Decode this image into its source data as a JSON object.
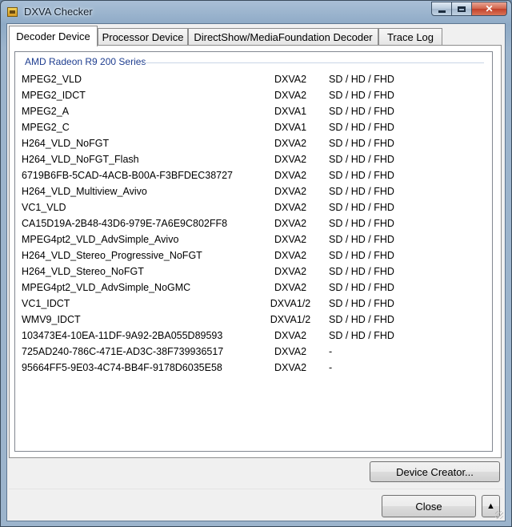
{
  "window": {
    "title": "DXVA Checker"
  },
  "tabs": [
    {
      "label": "Decoder Device"
    },
    {
      "label": "Processor Device"
    },
    {
      "label": "DirectShow/MediaFoundation Decoder"
    },
    {
      "label": "Trace Log"
    }
  ],
  "active_tab": "Decoder Device",
  "group": {
    "title": "AMD Radeon R9 200 Series"
  },
  "rows": [
    {
      "name": "MPEG2_VLD",
      "api": "DXVA2",
      "res": "SD / HD / FHD"
    },
    {
      "name": "MPEG2_IDCT",
      "api": "DXVA2",
      "res": "SD / HD / FHD"
    },
    {
      "name": "MPEG2_A",
      "api": "DXVA1",
      "res": "SD / HD / FHD"
    },
    {
      "name": "MPEG2_C",
      "api": "DXVA1",
      "res": "SD / HD / FHD"
    },
    {
      "name": "H264_VLD_NoFGT",
      "api": "DXVA2",
      "res": "SD / HD / FHD"
    },
    {
      "name": "H264_VLD_NoFGT_Flash",
      "api": "DXVA2",
      "res": "SD / HD / FHD"
    },
    {
      "name": "6719B6FB-5CAD-4ACB-B00A-F3BFDEC38727",
      "api": "DXVA2",
      "res": "SD / HD / FHD"
    },
    {
      "name": "H264_VLD_Multiview_Avivo",
      "api": "DXVA2",
      "res": "SD / HD / FHD"
    },
    {
      "name": "VC1_VLD",
      "api": "DXVA2",
      "res": "SD / HD / FHD"
    },
    {
      "name": "CA15D19A-2B48-43D6-979E-7A6E9C802FF8",
      "api": "DXVA2",
      "res": "SD / HD / FHD"
    },
    {
      "name": "MPEG4pt2_VLD_AdvSimple_Avivo",
      "api": "DXVA2",
      "res": "SD / HD / FHD"
    },
    {
      "name": "H264_VLD_Stereo_Progressive_NoFGT",
      "api": "DXVA2",
      "res": "SD / HD / FHD"
    },
    {
      "name": "H264_VLD_Stereo_NoFGT",
      "api": "DXVA2",
      "res": "SD / HD / FHD"
    },
    {
      "name": "MPEG4pt2_VLD_AdvSimple_NoGMC",
      "api": "DXVA2",
      "res": "SD / HD / FHD"
    },
    {
      "name": "VC1_IDCT",
      "api": "DXVA1/2",
      "res": "SD / HD / FHD"
    },
    {
      "name": "WMV9_IDCT",
      "api": "DXVA1/2",
      "res": "SD / HD / FHD"
    },
    {
      "name": "103473E4-10EA-11DF-9A92-2BA055D89593",
      "api": "DXVA2",
      "res": "SD / HD / FHD"
    },
    {
      "name": "725AD240-786C-471E-AD3C-38F739936517",
      "api": "DXVA2",
      "res": "-"
    },
    {
      "name": "95664FF5-9E03-4C74-BB4F-9178D6035E58",
      "api": "DXVA2",
      "res": "-"
    }
  ],
  "buttons": {
    "device_creator": "Device Creator...",
    "close": "Close",
    "up_glyph": "▲"
  },
  "caption": {
    "close_glyph": "✕"
  },
  "icons": [
    "app-icon",
    "minimize-icon",
    "maximize-icon",
    "close-icon",
    "up-arrow-icon"
  ]
}
